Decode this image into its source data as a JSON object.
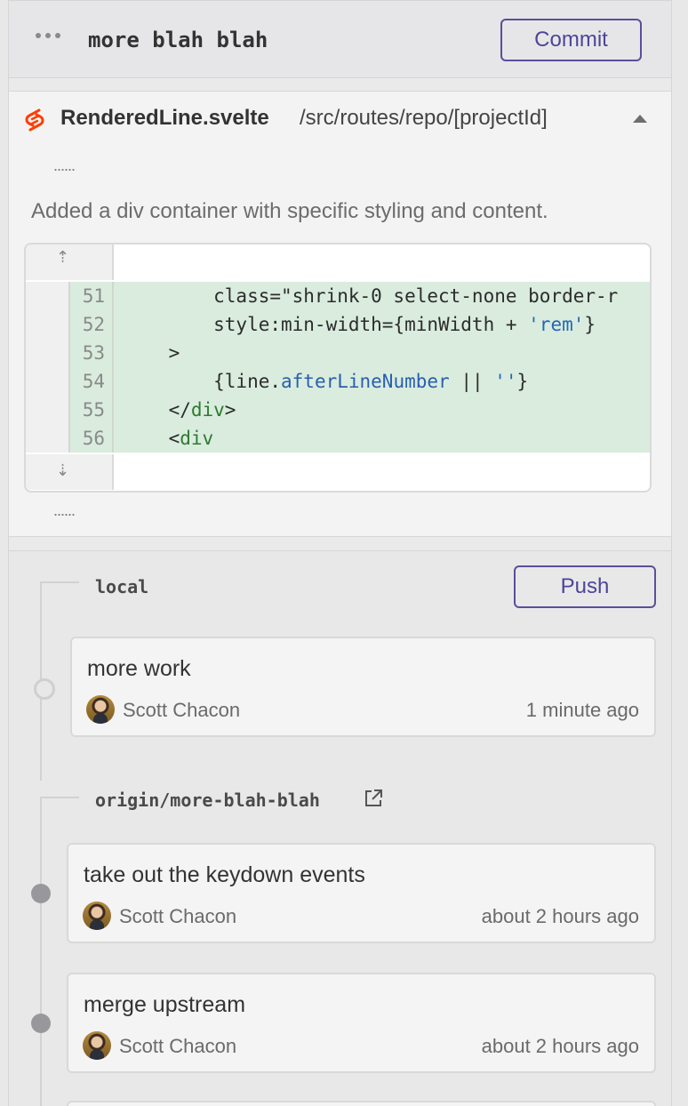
{
  "header": {
    "branch_name": "more blah blah",
    "commit_label": "Commit"
  },
  "file": {
    "name": "RenderedLine.svelte",
    "path": "/src/routes/repo/[projectId]",
    "ellipsis_top": "......",
    "ellipsis_bottom": "......",
    "description": "Added a div container with specific styling and content.",
    "lines": [
      {
        "num": "51",
        "text": "        class=\"shrink-0 select-none border-r"
      },
      {
        "num": "52",
        "text": "        style:min-width={minWidth + 'rem'}"
      },
      {
        "num": "53",
        "text": "    >"
      },
      {
        "num": "54",
        "text": "        {line.afterLineNumber || ''}"
      },
      {
        "num": "55",
        "text": "    </div>"
      },
      {
        "num": "56",
        "text": "    <div"
      }
    ]
  },
  "local": {
    "label": "local",
    "push_label": "Push",
    "commits": [
      {
        "message": "more work",
        "author": "Scott Chacon",
        "time": "1 minute ago"
      }
    ]
  },
  "remote": {
    "label": "origin/more-blah-blah",
    "commits": [
      {
        "message": "take out the keydown events",
        "author": "Scott Chacon",
        "time": "about 2 hours ago"
      },
      {
        "message": "merge upstream",
        "author": "Scott Chacon",
        "time": "about 2 hours ago"
      }
    ]
  },
  "colors": {
    "accent": "#4e4597",
    "added_line_bg": "#d9ecde",
    "svelte_orange": "#ff3e00"
  }
}
